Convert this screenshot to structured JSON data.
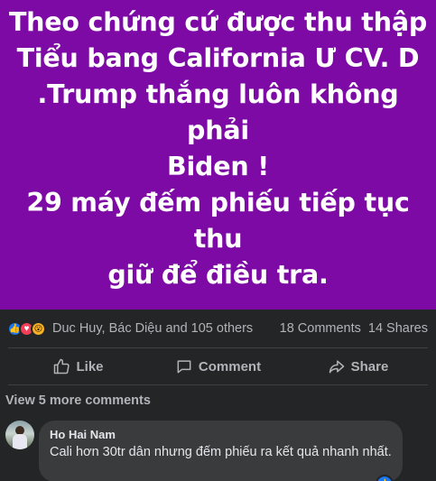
{
  "post": {
    "image_text": "Theo chứng cứ được thu thập\nTiểu bang California Ư CV. D\n.Trump thắng luôn không phải\nBiden !\n29 máy đếm phiếu tiếp tục thu\ngiữ để điều tra.",
    "image_background": "#7d0aa5"
  },
  "reactions": {
    "icons": [
      "like-icon",
      "love-icon",
      "wow-icon"
    ],
    "names": "Duc Huy, Bác Diệu and 105 others",
    "comments_count": "18 Comments",
    "shares_count": "14 Shares"
  },
  "actions": {
    "like_label": "Like",
    "comment_label": "Comment",
    "share_label": "Share"
  },
  "comments": {
    "view_more": "View 5 more comments",
    "items": [
      {
        "author": "Ho Hai Nam",
        "text": "Cali hơn 30tr dân nhưng đếm phiếu ra kết quả nhanh nhất."
      }
    ]
  },
  "colors": {
    "background": "#242526",
    "secondary_text": "#b0b3b8",
    "bubble": "#3a3b3c",
    "like_blue": "#1877f2"
  }
}
